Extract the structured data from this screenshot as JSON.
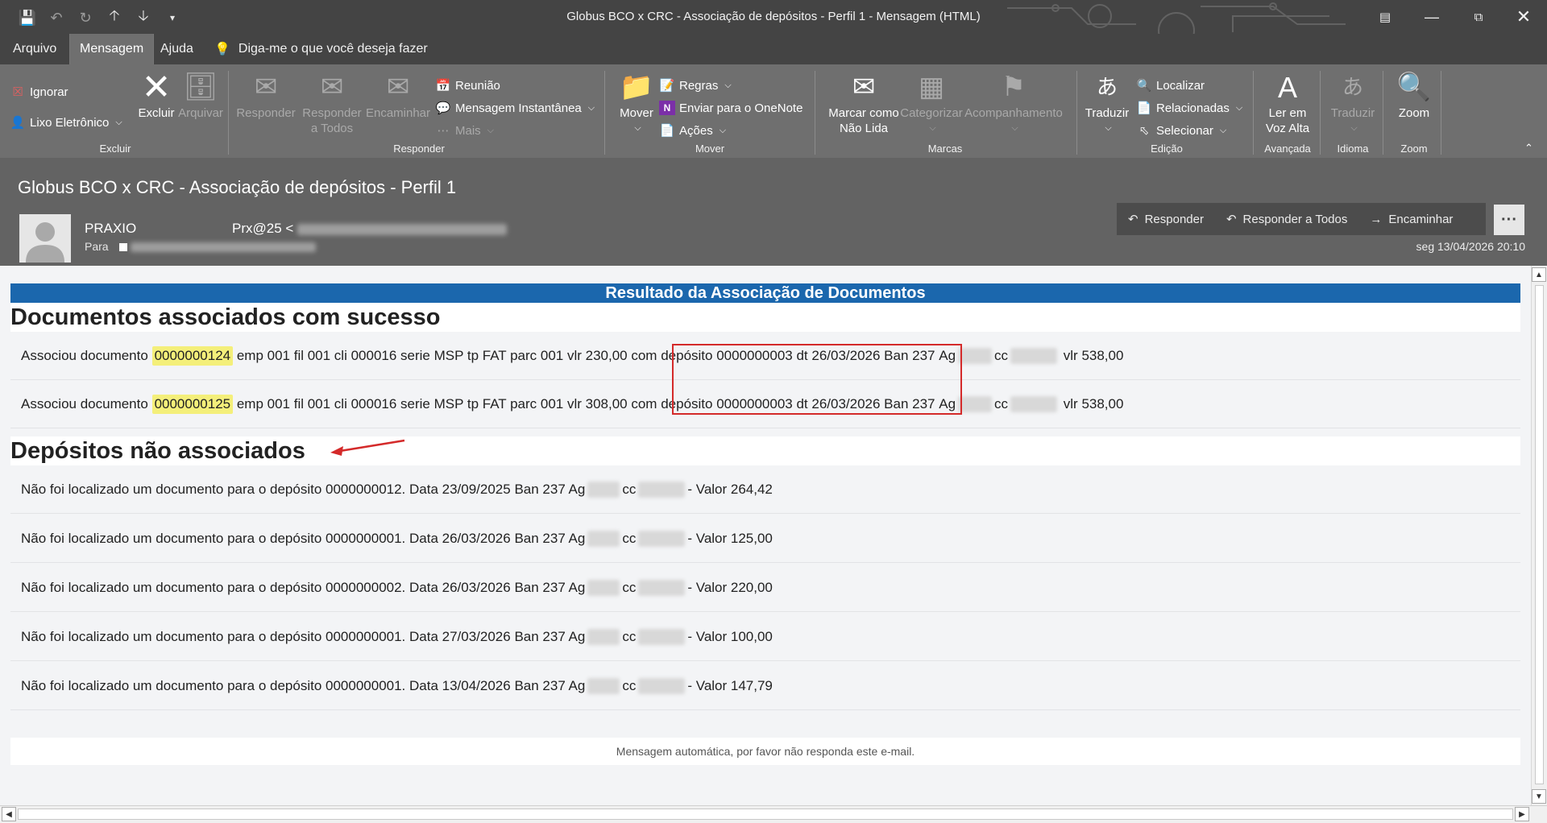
{
  "window": {
    "title": "Globus BCO x CRC - Associação de depósitos - Perfil 1  -  Mensagem (HTML)"
  },
  "menu": {
    "tabs": [
      "Arquivo",
      "Mensagem",
      "Ajuda"
    ],
    "active_tab": "Mensagem",
    "tell_me": "Diga-me o que você deseja fazer"
  },
  "ribbon": {
    "excluir_group": {
      "label": "Excluir",
      "ignorar": "Ignorar",
      "lixo": "Lixo Eletrônico",
      "excluir": "Excluir",
      "arquivar": "Arquivar"
    },
    "responder_group": {
      "label": "Responder",
      "responder": "Responder",
      "responder_todos_1": "Responder",
      "responder_todos_2": "a Todos",
      "encaminhar": "Encaminhar",
      "reuniao": "Reunião",
      "mensagem_instantanea": "Mensagem Instantânea",
      "mais": "Mais"
    },
    "mover_group": {
      "label": "Mover",
      "mover": "Mover",
      "regras": "Regras",
      "onenote": "Enviar para o OneNote",
      "acoes": "Ações"
    },
    "marcas_group": {
      "label": "Marcas",
      "marcar_1": "Marcar como",
      "marcar_2": "Não Lida",
      "categorizar": "Categorizar",
      "acompanhamento": "Acompanhamento"
    },
    "edicao_group": {
      "label": "Edição",
      "traduzir": "Traduzir",
      "localizar": "Localizar",
      "relacionadas": "Relacionadas",
      "selecionar": "Selecionar"
    },
    "avancada_group": {
      "label": "Avançada",
      "ler_1": "Ler em",
      "ler_2": "Voz Alta"
    },
    "idioma_group": {
      "label": "Idioma",
      "traduzir": "Traduzir"
    },
    "zoom_group": {
      "label": "Zoom",
      "zoom": "Zoom"
    }
  },
  "message": {
    "subject": "Globus BCO x CRC - Associação de depósitos - Perfil 1",
    "sender_name": "PRAXIO",
    "sender_address_prefix": "Prx@25 <",
    "to_label": "Para",
    "date": "seg 13/04/2026 20:10",
    "actions": {
      "reply": "Responder",
      "reply_all": "Responder a Todos",
      "forward": "Encaminhar",
      "more": "···"
    }
  },
  "body": {
    "banner": "Resultado da Associação de Documentos",
    "section_success": "Documentos associados com sucesso",
    "associated": [
      {
        "prefix": "Associou documento",
        "doc": "0000000124",
        "middle": "emp 001 fil 001 cli 000016 serie MSP tp FAT parc 001 vlr 230,00 com",
        "deposit": "depósito 0000000003 dt 26/03/2026 Ban 237",
        "ag": "Ag",
        "cc": "cc",
        "value": "vlr 538,00"
      },
      {
        "prefix": "Associou documento",
        "doc": "0000000125",
        "middle": "emp 001 fil 001 cli 000016 serie MSP tp FAT parc 001 vlr 308,00 com",
        "deposit": "depósito 0000000003 dt 26/03/2026 Ban 237",
        "ag": "Ag",
        "cc": "cc",
        "value": "vlr 538,00"
      }
    ],
    "section_unassociated": "Depósitos não associados",
    "unassociated": [
      {
        "text": "Não foi localizado um documento para o depósito 0000000012. Data 23/09/2025 Ban 237 Ag",
        "cc": "cc",
        "value": "- Valor 264,42"
      },
      {
        "text": "Não foi localizado um documento para o depósito 0000000001. Data 26/03/2026 Ban 237 Ag",
        "cc": "cc",
        "value": "- Valor 125,00"
      },
      {
        "text": "Não foi localizado um documento para o depósito 0000000002. Data 26/03/2026 Ban 237 Ag",
        "cc": "cc",
        "value": "- Valor 220,00"
      },
      {
        "text": "Não foi localizado um documento para o depósito 0000000001. Data 27/03/2026 Ban 237 Ag",
        "cc": "cc",
        "value": "- Valor 100,00"
      },
      {
        "text": "Não foi localizado um documento para o depósito 0000000001. Data 13/04/2026 Ban 237 Ag",
        "cc": "cc",
        "value": "- Valor 147,79"
      }
    ],
    "footer": "Mensagem automática, por favor não responda este e-mail."
  },
  "colors": {
    "chrome_dark": "#444444",
    "ribbon": "#6f6f6f",
    "header": "#636363",
    "banner": "#1b67ad",
    "highlight": "#f4ef7a",
    "annotation_red": "#d42a2a"
  }
}
